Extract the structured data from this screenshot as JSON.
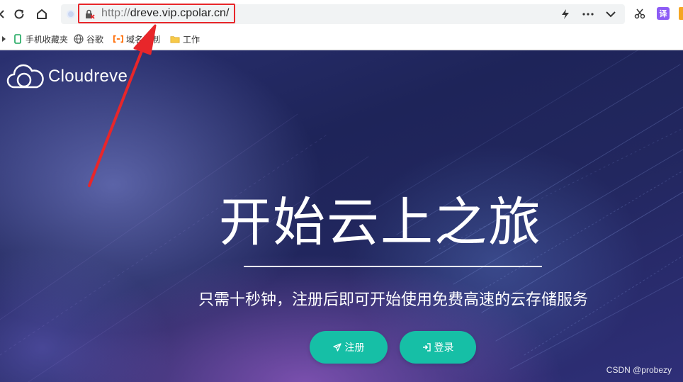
{
  "browser": {
    "url_scheme": "http://",
    "url_host": "dreve.vip.cpolar.cn/",
    "extension_translate_label": "译"
  },
  "bookmarks": [
    {
      "label": "手机收藏夹",
      "icon": "phone-icon"
    },
    {
      "label": "谷歌",
      "icon": "globe-icon"
    },
    {
      "label": "域名控制",
      "icon": "cloud-bracket-icon"
    },
    {
      "label": "工作",
      "icon": "folder-icon"
    }
  ],
  "hero": {
    "logo_text": "Cloudreve",
    "title": "开始云上之旅",
    "subtitle": "只需十秒钟，注册后即可开始使用免费高速的云存储服务",
    "register_label": "注册",
    "login_label": "登录"
  },
  "watermark": "CSDN @probezy",
  "colors": {
    "accent_button": "#16bfa6",
    "annotation_red": "#e8262a",
    "hero_bg": "#1e2459"
  }
}
